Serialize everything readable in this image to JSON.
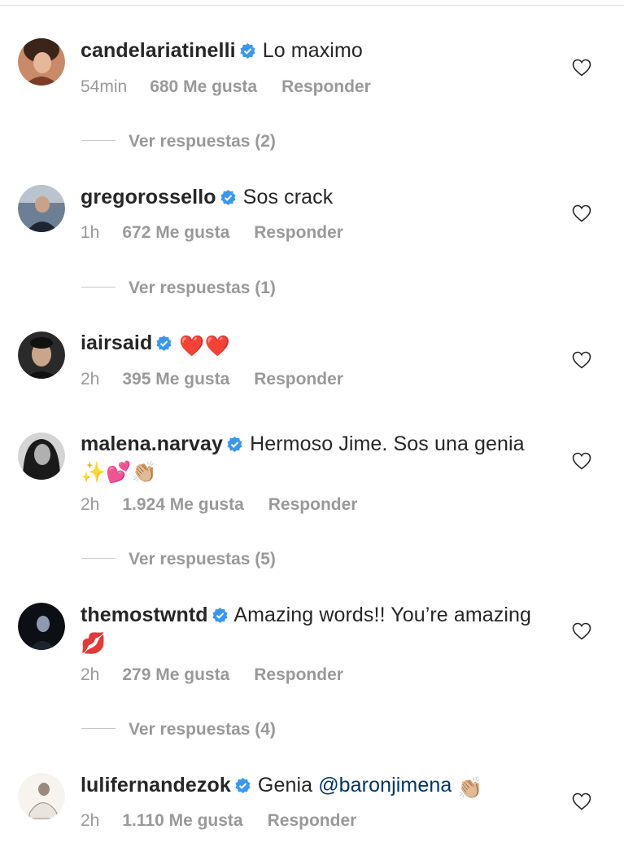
{
  "comments": [
    {
      "username": "candelariatinelli",
      "text": "Lo maximo",
      "emoji": [],
      "time": "54min",
      "likes": "680 Me gusta",
      "reply": "Responder",
      "view_replies": "Ver respuestas (2)",
      "avatar_colors": [
        "#c98a6a",
        "#3b2418",
        "#e7b79a"
      ]
    },
    {
      "username": "gregorossello",
      "text": "Sos crack",
      "emoji": [],
      "time": "1h",
      "likes": "672 Me gusta",
      "reply": "Responder",
      "view_replies": "Ver respuestas (1)",
      "avatar_colors": [
        "#6d7f94",
        "#1f2530",
        "#b9c4cf"
      ]
    },
    {
      "username": "iairsaid",
      "text": "",
      "emoji": [
        "❤️",
        "❤️"
      ],
      "time": "2h",
      "likes": "395 Me gusta",
      "reply": "Responder",
      "view_replies": "",
      "avatar_colors": [
        "#2a2a2a",
        "#111111",
        "#c9a58a"
      ]
    },
    {
      "username": "malena.narvay",
      "text": "Hermoso Jime. Sos una genia",
      "emoji": [
        "✨",
        "💕",
        "👏🏼"
      ],
      "time": "2h",
      "likes": "1.924 Me gusta",
      "reply": "Responder",
      "view_replies": "Ver respuestas (5)",
      "avatar_colors": [
        "#777777",
        "#1a1a1a",
        "#d4d4d4"
      ]
    },
    {
      "username": "themostwntd",
      "text": "Amazing words!! You’re amazing",
      "emoji": [
        "💋"
      ],
      "time": "2h",
      "likes": "279 Me gusta",
      "reply": "Responder",
      "view_replies": "Ver respuestas (4)",
      "avatar_colors": [
        "#1d2430",
        "#0c0f14",
        "#8c9bb0"
      ]
    },
    {
      "username": "lulifernandezok",
      "text": "Genia",
      "mention": "@baronjimena",
      "emoji": [
        "👏🏼"
      ],
      "time": "2h",
      "likes": "1.110 Me gusta",
      "reply": "Responder",
      "view_replies": "",
      "avatar_colors": [
        "#e9e4df",
        "#9a8b7e",
        "#f7f3ef"
      ]
    }
  ],
  "colors": {
    "text": "#262626",
    "meta": "#999999",
    "verified": "#3897f0",
    "mention": "#003569"
  }
}
